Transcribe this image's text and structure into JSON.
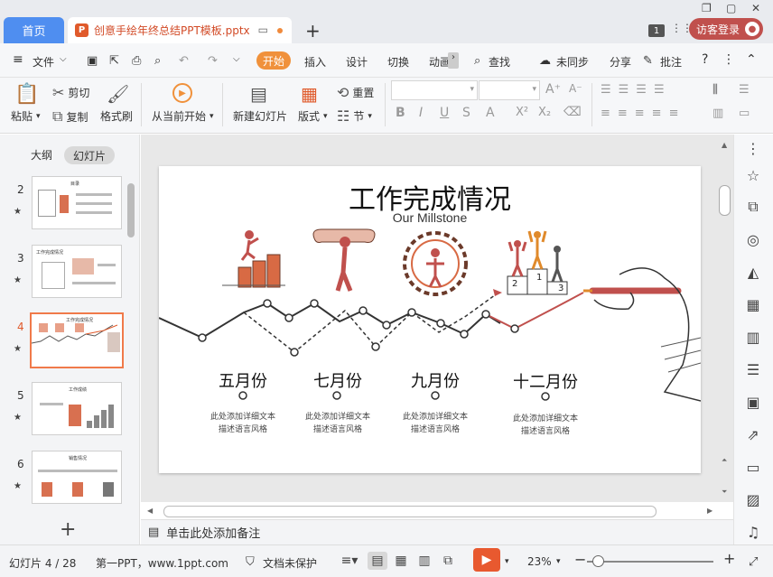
{
  "titlebar": {
    "home_tab": "首页",
    "doc_tab": "创意手绘年终总结PPT模板.pptx",
    "new_tab": "+",
    "badge": "1",
    "login": "访客登录"
  },
  "menu": {
    "file": "文件",
    "start": "开始",
    "insert": "插入",
    "design": "设计",
    "transition": "切换",
    "animation": "动画",
    "find": "查找",
    "sync": "未同步",
    "share": "分享",
    "annotate": "批注",
    "help": "?"
  },
  "ribbon": {
    "paste": "粘贴",
    "cut": "剪切",
    "copy": "复制",
    "format_painter": "格式刷",
    "from_current": "从当前开始",
    "new_slide": "新建幻灯片",
    "layout": "版式",
    "reset": "重置",
    "section": "节"
  },
  "left_panel": {
    "outline_tab": "大纲",
    "slides_tab": "幻灯片",
    "slides": [
      {
        "num": "2",
        "title": "目录"
      },
      {
        "num": "3",
        "title": "工作完成情况"
      },
      {
        "num": "4",
        "title": "工作完成情况"
      },
      {
        "num": "5",
        "title": "工作成绩"
      },
      {
        "num": "6",
        "title": "销售情况"
      }
    ],
    "star": "★"
  },
  "slide": {
    "title": "工作完成情况",
    "subtitle": "Our Millstone",
    "podium": [
      "2",
      "1",
      "3"
    ],
    "months": [
      {
        "label": "五月份",
        "desc1": "此处添加详细文本",
        "desc2": "描述语言风格"
      },
      {
        "label": "七月份",
        "desc1": "此处添加详细文本",
        "desc2": "描述语言风格"
      },
      {
        "label": "九月份",
        "desc1": "此处添加详细文本",
        "desc2": "描述语言风格"
      },
      {
        "label": "十二月份",
        "desc1": "此处添加详细文本",
        "desc2": "描述语言风格"
      }
    ]
  },
  "notes": {
    "placeholder": "单击此处添加备注"
  },
  "status": {
    "slide_count": "幻灯片 4 / 28",
    "theme": "第一PPT，www.1ppt.com",
    "protect": "文档未保护",
    "zoom": "23%",
    "minus": "−",
    "plus": "+"
  }
}
